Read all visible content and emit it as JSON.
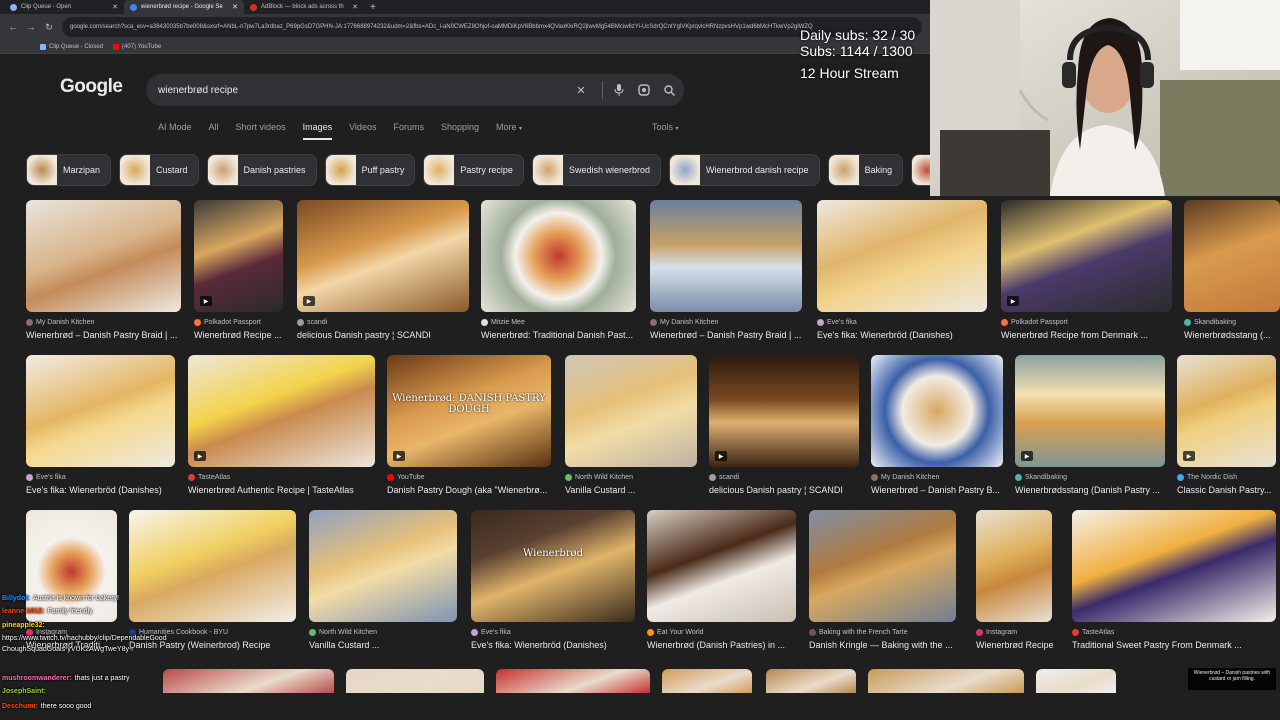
{
  "browser": {
    "tabs": [
      {
        "label": "Clip Queue - Open",
        "active": false
      },
      {
        "label": "wienerbrød recipe - Google Se",
        "active": true
      },
      {
        "label": "AdBlock — block ads across th",
        "active": false
      }
    ],
    "url": "google.com/search?sca_esv=a38430035b7be008&sxsrf=ANbL-n7pw7La3rdbaz_P69pGsD7GPHN-JA:1776688974232&udm=2&fbs=ADc_l-aN0CWEZ8Ohjof-oaMMDiKpV6Bbbmx4QVaoKkiRQ2jlwvMg54BMciw6zYi-UcSdrQCntYglVKprqvlcHRNzpvsHVp1wd6bMcHTkwVp2glWZQ",
    "bookmarks": [
      {
        "label": "Clip Queue - Closed",
        "color": "#8ab4f8"
      },
      {
        "label": "(407) YouTube",
        "color": "#ff0000"
      }
    ]
  },
  "search": {
    "logo": "Google",
    "query": "wienerbrød recipe",
    "filters": [
      "AI Mode",
      "All",
      "Short videos",
      "Images",
      "Videos",
      "Forums",
      "Shopping",
      "More"
    ],
    "active_filter": "Images",
    "tools": "Tools"
  },
  "chips": [
    {
      "label": "Marzipan",
      "color": "#b8894c"
    },
    {
      "label": "Custard",
      "color": "#d9a95a"
    },
    {
      "label": "Danish pastries",
      "color": "#c9a070"
    },
    {
      "label": "Puff pastry",
      "color": "#d4a24a"
    },
    {
      "label": "Pastry recipe",
      "color": "#e0b060"
    },
    {
      "label": "Swedish wienerbrod",
      "color": "#cfa36a"
    },
    {
      "label": "Wienerbrod danish recipe",
      "color": "#8fa4c8"
    },
    {
      "label": "Baking",
      "color": "#caa06a"
    },
    {
      "label": "",
      "color": "#b84d3a"
    }
  ],
  "images": {
    "row1": [
      {
        "source": "My Danish Kitchen",
        "title": "Wienerbrød – Danish Pastry Braid | ...",
        "fav": "#8d6e63",
        "bg": "linear-gradient(160deg,#e9e4dc 0%,#d8b48a 45%,#c48a5a 60%,#efe9e1 100%)"
      },
      {
        "source": "Polkadot Passport",
        "title": "Wienerbrød Recipe ...",
        "fav": "#ff7043",
        "bg": "linear-gradient(160deg,#3a3a3a 0%,#d9a760 40%,#5b2a3a 60%,#2a2a2a 100%)",
        "video": true
      },
      {
        "source": "scandi",
        "title": "delicious Danish pastry ¦ SCANDI",
        "fav": "#9e9e9e",
        "bg": "linear-gradient(160deg,#7a4a22 0%,#d99a4e 40%,#f2d7a8 55%,#8a5a2a 100%)",
        "video": true
      },
      {
        "source": "Mitzie Mee",
        "title": "Wienerbrød: Traditional Danish Past...",
        "fav": "#e0e0e0",
        "bg": "radial-gradient(circle at 50% 50%,#c0392b 0%,#e6a05a 25%,#f4f1ec 45%,#9fae9a 60%,#e8e4dc 100%)"
      },
      {
        "source": "My Danish Kitchen",
        "title": "Wienerbrød – Danish Pastry Braid | ...",
        "fav": "#8d6e63",
        "bg": "linear-gradient(180deg,#6b7f9a 0%,#c7a26a 40%,#d7e0ea 60%,#7a8ea8 100%)"
      },
      {
        "source": "Eve's fika",
        "title": "Eve's fika: Wienerbröd (Danishes)",
        "fav": "#c5a3d9",
        "bg": "linear-gradient(160deg,#efe9e0 0%,#e0b56a 40%,#f2d38c 60%,#eee8df 100%)"
      },
      {
        "source": "Polkadot Passport",
        "title": "Wienerbrød Recipe from Denmark ...",
        "fav": "#ff7043",
        "bg": "linear-gradient(160deg,#2b2b2b 0%,#e0c070 35%,#4a3a6a 55%,#2b2b2b 100%)",
        "video": true
      },
      {
        "source": "Skandibaking",
        "title": "Wienerbrødsstang (...",
        "fav": "#4db6ac",
        "bg": "linear-gradient(160deg,#5a3a22 0%,#d99a4e 45%,#c27a3a 100%)"
      }
    ],
    "row2": [
      {
        "source": "Eve's fika",
        "title": "Eve's fika: Wienerbröd (Danishes)",
        "fav": "#c5a3d9",
        "bg": "linear-gradient(160deg,#f1ece4 0%,#e4b664 45%,#f5d98e 60%,#efe9e0 100%)"
      },
      {
        "source": "TasteAtlas",
        "title": "Wienerbrød Authentic Recipe | TasteAtlas",
        "fav": "#e53935",
        "bg": "linear-gradient(160deg,#ede6dc 0%,#f3d34a 40%,#c98a4e 55%,#ede6dc 100%)",
        "video": true
      },
      {
        "source": "YouTube",
        "title": "Danish Pastry Dough (aka \"Wienerbrø...",
        "fav": "#ff0000",
        "bg": "linear-gradient(160deg,#6a3a16 0%,#d99a4e 40%,#e8b66a 60%,#5a3010 100%)",
        "video": true,
        "overlay": "Wienerbrød: DANISH PASTRY DOUGH"
      },
      {
        "source": "North Wild Kitchen",
        "title": "Vanilla Custard ...",
        "fav": "#66bb6a",
        "bg": "linear-gradient(160deg,#cfc6b8 0%,#e6c07a 40%,#f3dca6 60%,#bdb3a3 100%)"
      },
      {
        "source": "scandi",
        "title": "delicious Danish pastry ¦ SCANDI",
        "fav": "#9e9e9e",
        "bg": "linear-gradient(180deg,#2a1a10 0%,#7a4a22 40%,#e0b070 60%,#3a2414 100%)",
        "video": true
      },
      {
        "source": "My Danish Kitchen",
        "title": "Wienerbrød – Danish Pastry B...",
        "fav": "#8d6e63",
        "bg": "radial-gradient(circle at 50% 50%,#d9a760 0%,#f1ece4 40%,#3b5fa8 60%,#eef1f6 100%)"
      },
      {
        "source": "Skandibaking",
        "title": "Wienerbrødsstang (Danish Pastry ...",
        "fav": "#4db6ac",
        "bg": "linear-gradient(180deg,#8aa0a0 0%,#f3e2b0 35%,#d8a050 60%,#7f9696 100%)",
        "video": true
      },
      {
        "source": "The Nordic Dish",
        "title": "Classic Danish Pastry...",
        "fav": "#42a5f5",
        "bg": "linear-gradient(160deg,#e8e1d6 0%,#e0b15e 40%,#f0d080 55%,#e8e1d6 100%)",
        "video": true
      }
    ],
    "row3": [
      {
        "source": "Instagram",
        "title": "Wienerbrød Traditi...",
        "fav": "#e1306c",
        "bg": "radial-gradient(circle at 50% 55%,#c0392b 0%,#e6a05a 25%,#f5f2ed 45%,#ece7df 100%)"
      },
      {
        "source": "Humanities Cookbook - BYU",
        "title": "Danish Pastry (Weinerbrod) Recipe",
        "fav": "#1e3a8a",
        "bg": "linear-gradient(160deg,#f7f4ee 0%,#f0d060 40%,#d9a860 55%,#f3efe9 100%)"
      },
      {
        "source": "North Wild Kitchen",
        "title": "Vanilla Custard ...",
        "fav": "#66bb6a",
        "bg": "linear-gradient(160deg,#8fa2c0 0%,#e6c07a 40%,#f3dca6 55%,#7f93b2 100%)"
      },
      {
        "source": "Eve's fika",
        "title": "Eve's fika: Wienerbröd (Danishes)",
        "fav": "#c5a3d9",
        "bg": "linear-gradient(160deg,#3a2a1e 0%,#5a4030 30%,#e0b56a 55%,#3a2a1e 100%)",
        "overlay": "Wienerbrød"
      },
      {
        "source": "Eat Your World",
        "title": "Wienerbrød (Danish Pastries) in ...",
        "fav": "#ff9800",
        "bg": "linear-gradient(160deg,#d9cfc3 0%,#4a2a18 40%,#f0ebe5 60%,#c9bfb3 100%)"
      },
      {
        "source": "Baking with the French Tarte",
        "title": "Danish Kringle — Baking with the ...",
        "fav": "#795548",
        "bg": "linear-gradient(160deg,#7f8fa2 0%,#b07a40 40%,#d9a860 55%,#6f7f92 100%)"
      },
      {
        "source": "Instagram",
        "title": "Wienerbrød Recipe",
        "fav": "#e1306c",
        "bg": "linear-gradient(160deg,#e8e1d6 0%,#e0b15e 40%,#c8883e 60%,#e8e1d6 100%)"
      },
      {
        "source": "TasteAtlas",
        "title": "Traditional Sweet Pastry From Denmark ...",
        "fav": "#e53935",
        "bg": "linear-gradient(160deg,#f5f0ea 0%,#f0b040 40%,#3a2a6a 55%,#f5f0ea 100%)"
      }
    ],
    "row4_colors": [
      "#b94a4a",
      "#e6d6c6",
      "#c43030",
      "#d29a5a",
      "#b8864e",
      "#c89a5a",
      "#eeeeee"
    ]
  },
  "stream": {
    "daily_subs": "Daily subs: 32 / 30",
    "subs": "Subs: 1144 / 1300",
    "stream_label": "12 Hour Stream"
  },
  "chat": [
    {
      "user": "Billydot:",
      "text": "Austria is known for bakery!",
      "color": "#1e90ff"
    },
    {
      "user": "leanne-1812:",
      "text": "Family friendly",
      "color": "#ff4500"
    },
    {
      "user": "pineapple32:",
      "text": "",
      "color": "#ffd700"
    },
    {
      "user": "",
      "text": "https://www.twitch.tv/hachubby/clip/DependableGood",
      "color": "#ffffff"
    },
    {
      "user": "",
      "text": "ChoughSquadGoals-yVUK2AWgTweY8y-r",
      "color": "#ffffff"
    },
    {
      "user": "mushroomwanderer:",
      "text": "thats just a pastry",
      "color": "#ff69b4"
    },
    {
      "user": "JosephSaint:",
      "text": "",
      "color": "#9acd32"
    },
    {
      "user": "Deschumi:",
      "text": "there sooo good",
      "color": "#ff4500"
    }
  ],
  "tooltip": "Wienerbrød – Danish pastries with custard or jam filling."
}
